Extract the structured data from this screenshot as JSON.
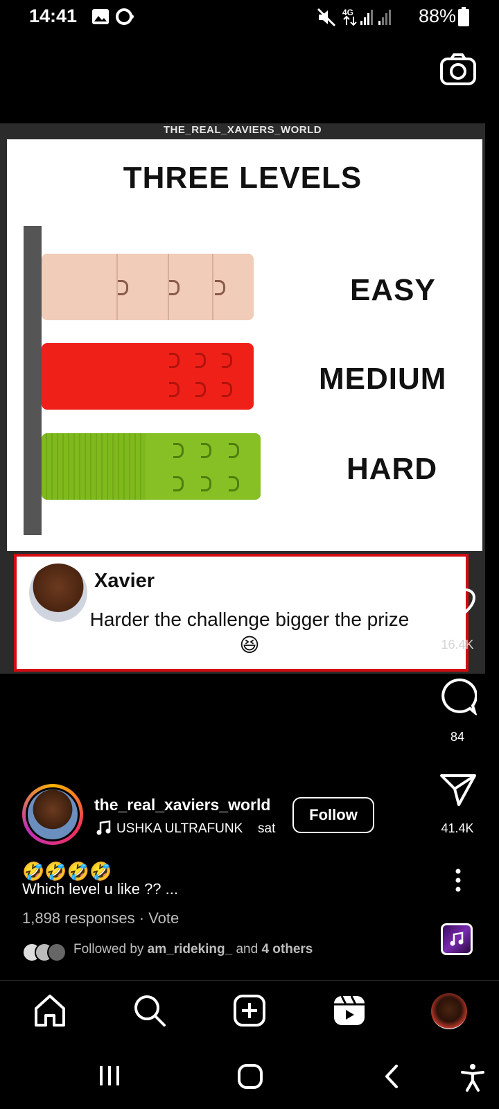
{
  "status_bar": {
    "time": "14:41",
    "battery": "88%",
    "network": "4G"
  },
  "media": {
    "watermark": "THE_REAL_XAVIERS_WORLD",
    "title": "THREE LEVELS",
    "levels": [
      "EASY",
      "MEDIUM",
      "HARD"
    ],
    "comment": {
      "name": "Xavier",
      "text": "Harder the challenge bigger the prize 😆"
    }
  },
  "right_rail": {
    "likes": "16.4K",
    "comments": "84",
    "shares": "41.4K"
  },
  "post": {
    "username": "the_real_xaviers_world",
    "music": "USHKA ULTRAFUNK",
    "music_extra": "sat",
    "follow_label": "Follow",
    "emojis": "🤣🤣🤣🤣",
    "caption": "Which level u like ?? ...",
    "responses": "1,898 responses · Vote",
    "followed_by_prefix": "Followed by ",
    "followed_by_user": "am_rideking_",
    "followed_by_suffix": " and ",
    "followed_by_others": "4 others"
  },
  "icons": {
    "camera": "camera-icon",
    "heart": "heart-icon",
    "comment": "comment-icon",
    "share": "send-icon",
    "more": "more-icon",
    "home": "home-icon",
    "search": "search-icon",
    "create": "create-icon",
    "reels": "reels-icon"
  },
  "colors": {
    "accent_red": "#d10c12",
    "background": "#000000"
  }
}
